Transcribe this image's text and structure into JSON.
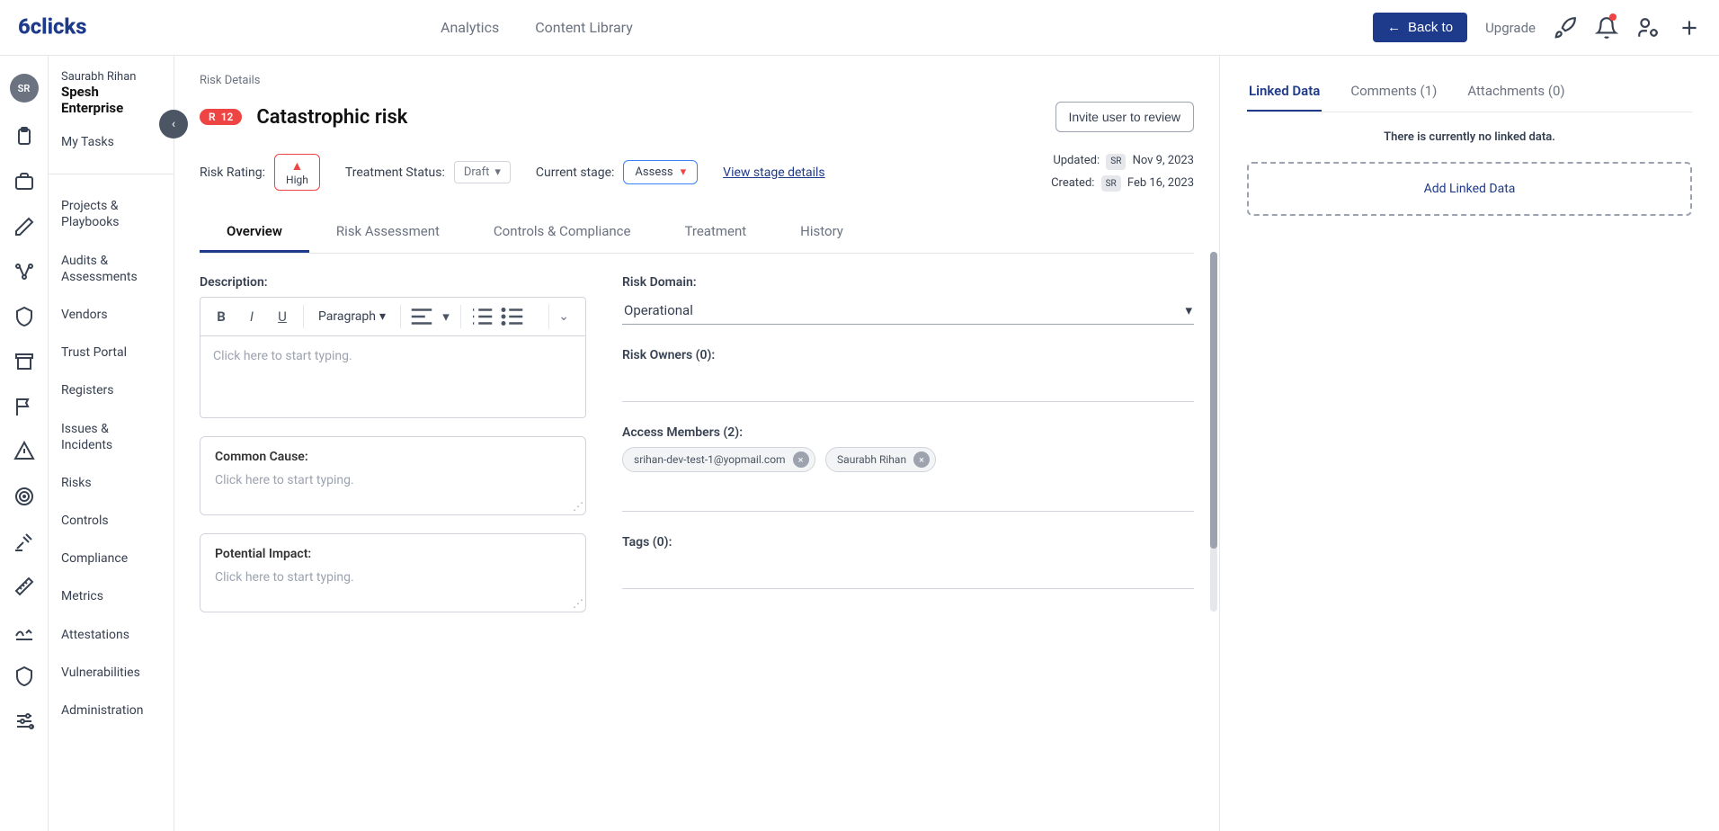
{
  "header": {
    "logo_text": "6clicks",
    "nav": [
      "Analytics",
      "Content Library"
    ],
    "back_label": "Back to",
    "upgrade_label": "Upgrade"
  },
  "sidebar": {
    "user_name": "Saurabh Rihan",
    "org_name": "Spesh Enterprise",
    "user_initials": "SR",
    "items": [
      "My Tasks",
      "Projects & Playbooks",
      "Audits & Assessments",
      "Vendors",
      "Trust Portal",
      "Registers",
      "Issues & Incidents",
      "Risks",
      "Controls",
      "Compliance",
      "Metrics",
      "Attestations",
      "Vulnerabilities",
      "Administration"
    ]
  },
  "breadcrumb": "Risk Details",
  "risk": {
    "badge_letter": "R",
    "badge_num": "12",
    "title": "Catastrophic risk",
    "invite_btn": "Invite user to review",
    "rating_label": "Risk Rating:",
    "rating_value": "High",
    "treatment_label": "Treatment Status:",
    "treatment_value": "Draft",
    "stage_label": "Current stage:",
    "stage_value": "Assess",
    "view_stage": "View stage details",
    "updated_label": "Updated:",
    "updated_initials": "SR",
    "updated_date": "Nov 9, 2023",
    "created_label": "Created:",
    "created_initials": "SR",
    "created_date": "Feb 16, 2023"
  },
  "tabs": [
    "Overview",
    "Risk Assessment",
    "Controls & Compliance",
    "Treatment",
    "History"
  ],
  "editor": {
    "desc_label": "Description:",
    "paragraph_label": "Paragraph",
    "placeholder": "Click here to start typing.",
    "cause_label": "Common Cause:",
    "impact_label": "Potential Impact:"
  },
  "right_fields": {
    "domain_label": "Risk Domain:",
    "domain_value": "Operational",
    "owners_label": "Risk Owners (0):",
    "members_label": "Access Members (2):",
    "member1": "srihan-dev-test-1@yopmail.com",
    "member2": "Saurabh Rihan",
    "tags_label": "Tags (0):"
  },
  "right_panel": {
    "tabs": [
      "Linked Data",
      "Comments (1)",
      "Attachments (0)"
    ],
    "empty_msg": "There is currently no linked data.",
    "add_label": "Add Linked Data"
  }
}
